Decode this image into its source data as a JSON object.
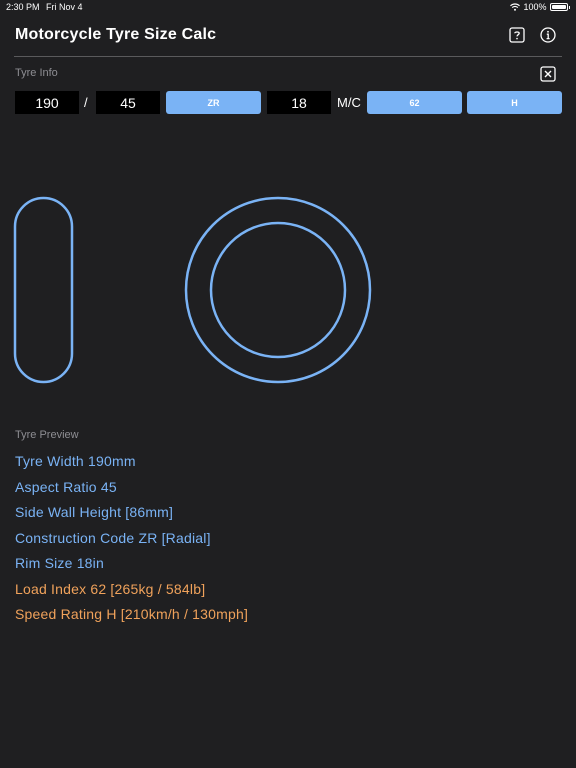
{
  "status": {
    "time": "2:30 PM",
    "date": "Fri Nov 4",
    "battery": "100%"
  },
  "nav": {
    "title": "Motorcycle Tyre Size Calc",
    "help_icon": "question-mark-icon",
    "info_icon": "info-icon"
  },
  "tyre_info": {
    "label": "Tyre Info",
    "close_icon": "close-icon",
    "width": "190",
    "slash": "/",
    "aspect": "45",
    "construction": "ZR",
    "rim": "18",
    "mc": "M/C",
    "load_index": "62",
    "speed_rating": "H"
  },
  "preview": {
    "label": "Tyre Preview",
    "lines": [
      "Tyre Width 190mm",
      "Aspect Ratio 45",
      "Side Wall Height [86mm]",
      "Construction Code ZR [Radial]",
      "Rim Size 18in",
      "Load Index 62 [265kg / 584lb]",
      "Speed Rating H [210km/h / 130mph]"
    ]
  },
  "colors": {
    "accent": "#7ab3f5",
    "orange": "#f0a25b",
    "background": "#1f1f21"
  }
}
